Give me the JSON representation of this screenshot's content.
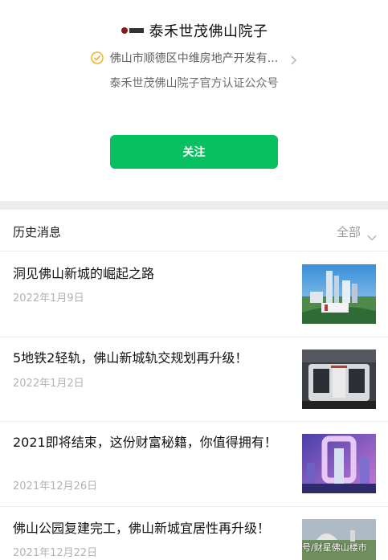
{
  "header": {
    "logo_text": "佛山院子",
    "account_name": "泰禾世茂佛山院子",
    "verify_text": "佛山市顺德区中维房地产开发有...",
    "subtitle": "泰禾世茂佛山院子官方认证公众号",
    "follow_label": "关注"
  },
  "history": {
    "title": "历史消息",
    "filter_label": "全部"
  },
  "articles": [
    {
      "title": "洞见佛山新城的崛起之路",
      "date": "2022年1月9日"
    },
    {
      "title": "5地铁2轻轨，佛山新城轨交规划再升级！",
      "date": "2022年1月2日"
    },
    {
      "title": "2021即将结束，这份财富秘籍，你值得拥有！",
      "date": "2021年12月26日"
    },
    {
      "title": "佛山公园复建完工，佛山新城宜居性再升级！",
      "date": "2021年12月22日",
      "thumb_caption": "号/财星佛山楼市"
    }
  ],
  "colors": {
    "accent": "#07c160",
    "verify_badge": "#f0b429",
    "muted": "#b2b2b2"
  },
  "icons": {
    "verify": "verified-badge-icon",
    "chevron_right": "chevron-right-icon",
    "chevron_down": "chevron-down-icon"
  }
}
